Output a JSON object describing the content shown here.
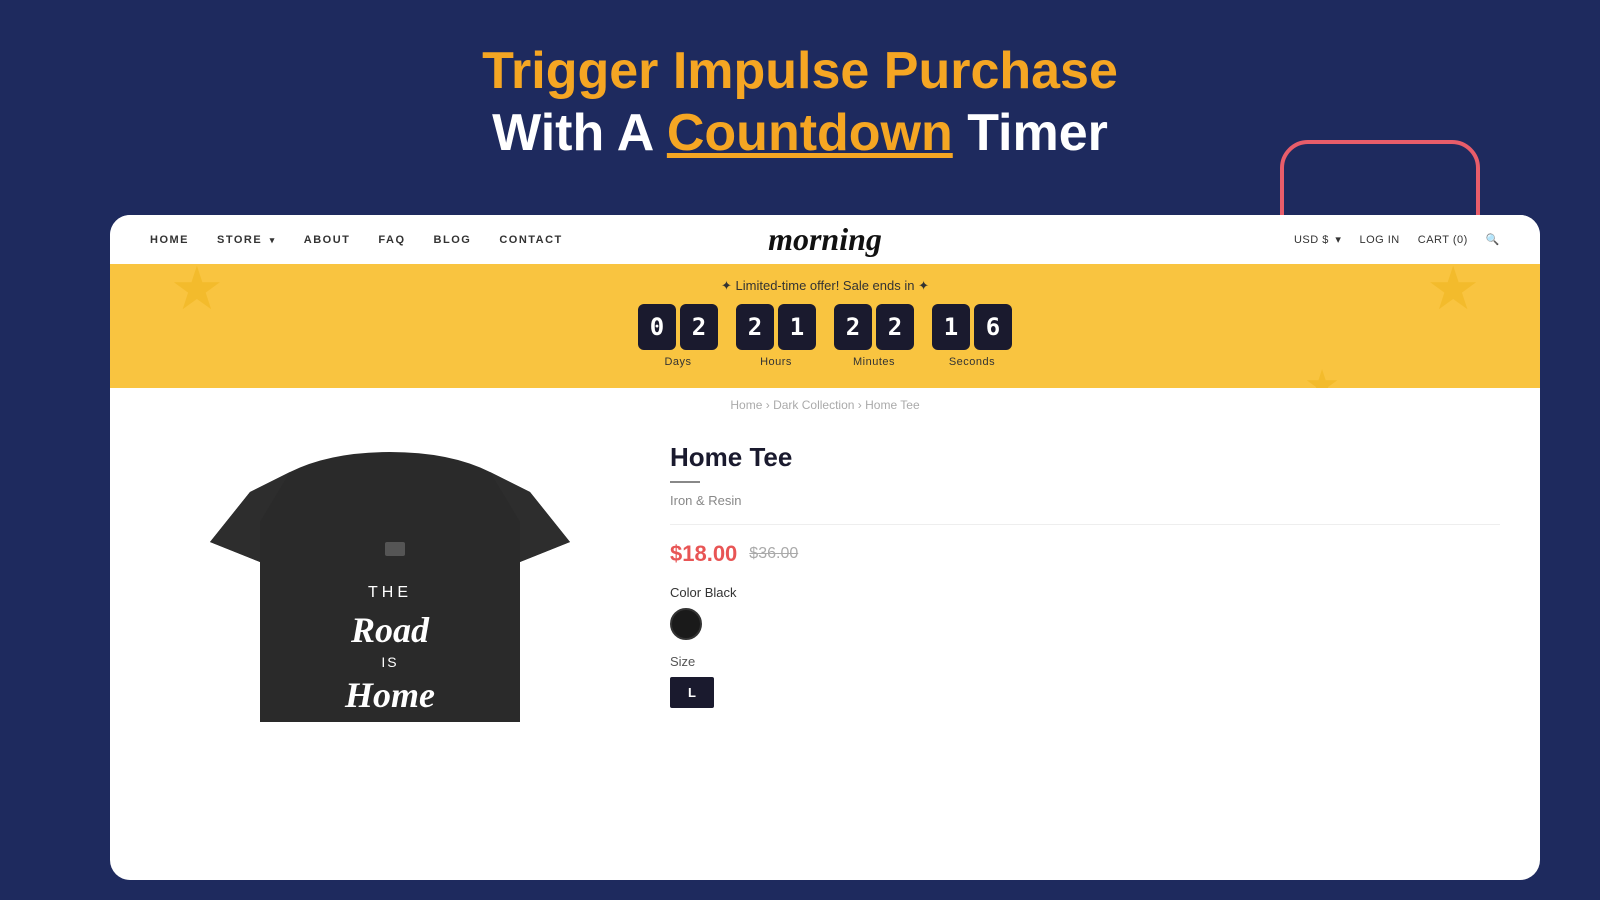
{
  "page": {
    "background_color": "#1e2a5e"
  },
  "header": {
    "line1": "Trigger Impulse Purchase",
    "line2_white": "With A ",
    "line2_highlight": "Countdown",
    "line2_end": " Timer"
  },
  "nav": {
    "items": [
      {
        "label": "HOME",
        "has_dropdown": false
      },
      {
        "label": "STORE",
        "has_dropdown": true
      },
      {
        "label": "ABOUT",
        "has_dropdown": false
      },
      {
        "label": "FAQ",
        "has_dropdown": false
      },
      {
        "label": "BLOG",
        "has_dropdown": false
      },
      {
        "label": "CONTACT",
        "has_dropdown": false
      }
    ],
    "logo": "morning",
    "right_items": [
      {
        "label": "USD $",
        "has_dropdown": true
      },
      {
        "label": "LOG IN"
      },
      {
        "label": "CART (0)"
      }
    ],
    "search_icon": "🔍"
  },
  "banner": {
    "offer_text": "✦ Limited-time offer! Sale ends in ✦",
    "timer": {
      "days": [
        "0",
        "2"
      ],
      "hours": [
        "2",
        "1"
      ],
      "minutes": [
        "2",
        "2"
      ],
      "seconds": [
        "1",
        "6"
      ]
    },
    "labels": [
      "Days",
      "Hours",
      "Minutes",
      "Seconds"
    ]
  },
  "breadcrumb": {
    "items": [
      "Home",
      "Dark Collection",
      "Home Tee"
    ]
  },
  "product": {
    "title": "Home Tee",
    "brand": "Iron & Resin",
    "price_sale": "$18.00",
    "price_original": "$36.00",
    "color_label": "Color",
    "color_value": "Black",
    "size_label": "Size",
    "size_selected": "L"
  }
}
